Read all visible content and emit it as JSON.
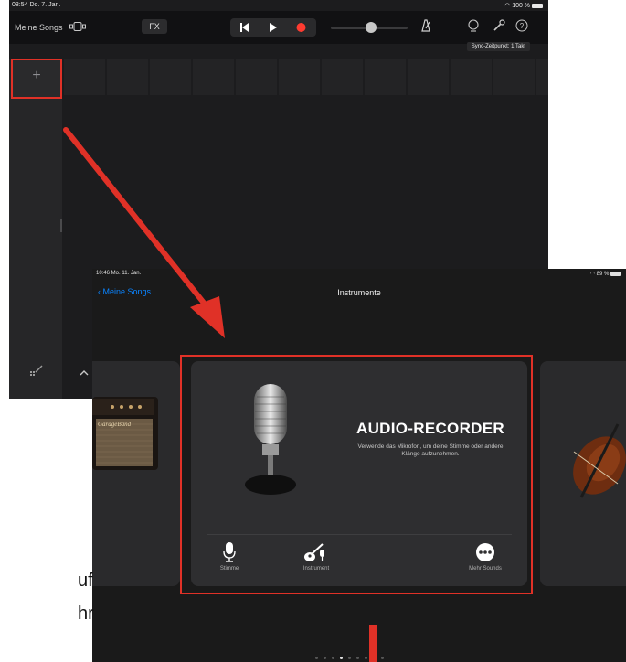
{
  "screen1": {
    "status": {
      "time": "08:54  Do. 7. Jan.",
      "battery": "100 %"
    },
    "toolbar": {
      "back_label": "Meine Songs",
      "fx_label": "FX",
      "sync_label": "Sync-Zeitpunkt: 1 Takt"
    },
    "add_track_label": "+"
  },
  "screen2": {
    "status": {
      "time": "10:46  Mo. 11. Jan.",
      "battery": "89 %"
    },
    "back_label": "Meine Songs",
    "title": "Instrumente",
    "card": {
      "heading": "AUDIO-RECORDER",
      "description": "Verwende das Mikrofon, um deine Stimme oder andere Klänge aufzunehmen.",
      "options": [
        {
          "label": "Stimme",
          "icon": "microphone-icon"
        },
        {
          "label": "Instrument",
          "icon": "guitar-mic-icon"
        },
        {
          "label": "Mehr Sounds",
          "icon": "more-icon"
        }
      ]
    },
    "amp_brand": "GarageBand",
    "page_count": 9,
    "page_index": 3
  },
  "side_text": {
    "line1": "uf",
    "line2": "hr"
  },
  "colors": {
    "highlight": "#e03127",
    "accent_blue": "#0a84ff"
  }
}
